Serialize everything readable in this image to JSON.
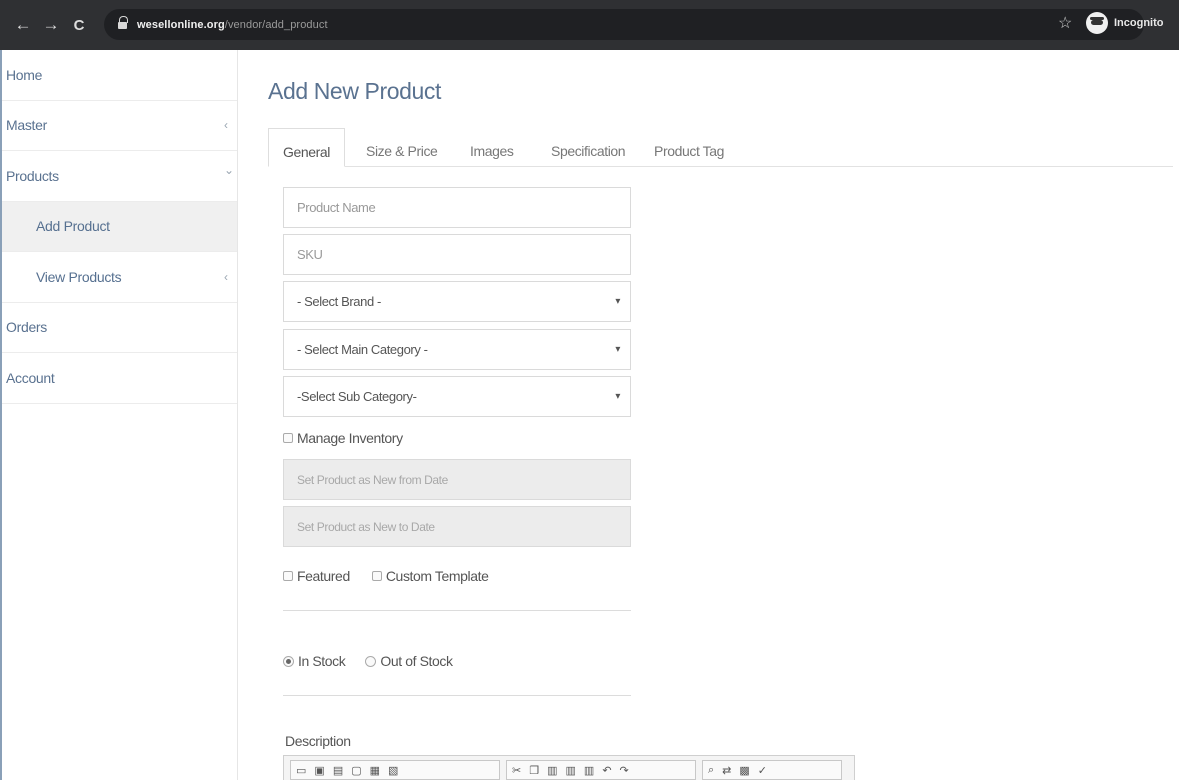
{
  "browser": {
    "url_host": "wesellonline.org",
    "url_path": "/vendor/add_product",
    "incognito_label": "Incognito"
  },
  "sidebar": {
    "items": [
      {
        "label": "Home"
      },
      {
        "label": "Master"
      },
      {
        "label": "Products"
      },
      {
        "label": "Add Product"
      },
      {
        "label": "View Products"
      },
      {
        "label": "Orders"
      },
      {
        "label": "Account"
      }
    ]
  },
  "main": {
    "title": "Add New Product",
    "tabs": [
      {
        "label": "General"
      },
      {
        "label": "Size & Price"
      },
      {
        "label": "Images"
      },
      {
        "label": "Specification"
      },
      {
        "label": "Product Tag"
      }
    ],
    "form": {
      "product_name_placeholder": "Product Name",
      "sku_placeholder": "SKU",
      "brand_selected": "- Select Brand -",
      "main_category_selected": "- Select Main Category -",
      "sub_category_selected": "-Select Sub Category-",
      "manage_inventory_label": "Manage Inventory",
      "new_from_placeholder": "Set Product as New from Date",
      "new_to_placeholder": "Set Product as New to Date",
      "featured_label": "Featured",
      "custom_template_label": "Custom Template",
      "in_stock_label": "In Stock",
      "out_of_stock_label": "Out of Stock",
      "description_label": "Description"
    }
  },
  "icons": {
    "back": "←",
    "forward": "→",
    "reload": "C",
    "star": "☆",
    "chevron_left": "‹",
    "chevron_down": "⌄",
    "caret": "▾"
  }
}
